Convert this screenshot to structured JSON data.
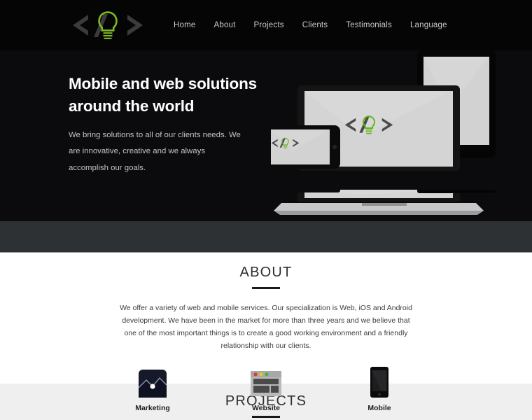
{
  "header": {
    "logo": {
      "icon": "code-bulb-logo",
      "alt": "</> lightbulb logo",
      "chevron_color": "#3b3b3b",
      "bulb_color": "#7fba27"
    },
    "nav": [
      {
        "label": "Home"
      },
      {
        "label": "About"
      },
      {
        "label": "Projects"
      },
      {
        "label": "Clients"
      },
      {
        "label": "Testimonials"
      },
      {
        "label": "Language"
      }
    ]
  },
  "hero": {
    "title": "Mobile and web solutions around the world",
    "subtitle": "We bring solutions to all of our clients needs. We are innovative, creative and we always accomplish our goals.",
    "background_color": "#0b0b0d",
    "band_color": "#2d3133",
    "devices": [
      {
        "name": "laptop",
        "screen_icon": "code-bulb-logo"
      },
      {
        "name": "tablet",
        "screen_icon": "code-bulb-logo"
      },
      {
        "name": "phone",
        "screen_icon": "code-bulb-logo"
      }
    ]
  },
  "about": {
    "title": "ABOUT",
    "text": "We offer a variety of web and mobile services. Our specialization is Web, iOS and Android development. We have been in the market for more than three years and we believe that one of the most important things is to create a good working environment and a friendly relationship with our clients.",
    "services": [
      {
        "label": "Marketing",
        "icon": "chart-icon"
      },
      {
        "label": "Website",
        "icon": "browser-window-icon"
      },
      {
        "label": "Mobile",
        "icon": "smartphone-icon"
      }
    ]
  },
  "projects": {
    "title": "PROJECTS"
  }
}
